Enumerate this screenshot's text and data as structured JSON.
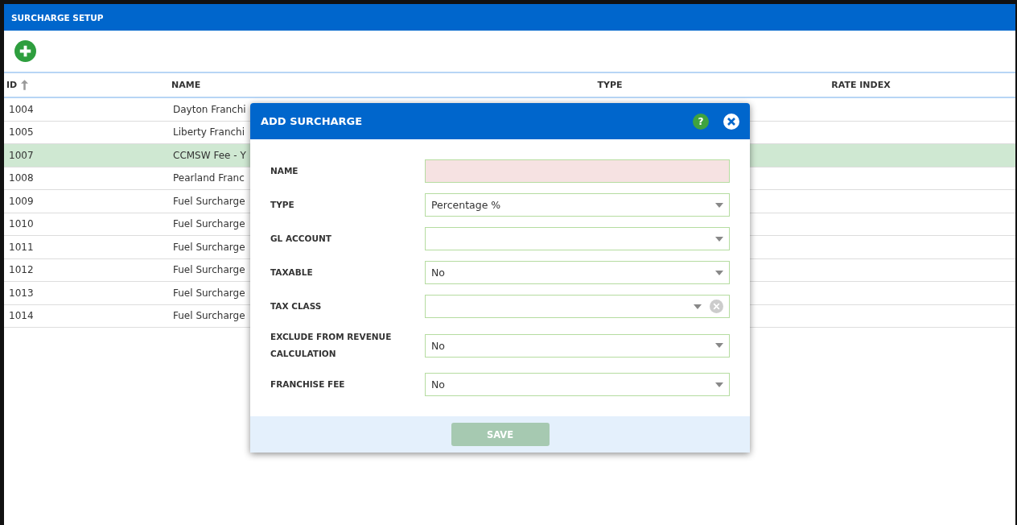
{
  "page": {
    "title": "SURCHARGE SETUP"
  },
  "table": {
    "columns": [
      {
        "label": "ID",
        "sorted": true
      },
      {
        "label": "NAME",
        "sorted": false
      },
      {
        "label": "TYPE",
        "sorted": false
      },
      {
        "label": "RATE INDEX",
        "sorted": false
      }
    ],
    "rows": [
      {
        "id": "1004",
        "name": "Dayton Franchi",
        "selected": false
      },
      {
        "id": "1005",
        "name": "Liberty Franchi",
        "selected": false
      },
      {
        "id": "1007",
        "name": "CCMSW Fee - Y",
        "selected": true
      },
      {
        "id": "1008",
        "name": "Pearland Franc",
        "selected": false
      },
      {
        "id": "1009",
        "name": "Fuel Surcharge",
        "selected": false
      },
      {
        "id": "1010",
        "name": "Fuel Surcharge",
        "selected": false
      },
      {
        "id": "1011",
        "name": "Fuel Surcharge",
        "selected": false
      },
      {
        "id": "1012",
        "name": "Fuel Surcharge",
        "selected": false
      },
      {
        "id": "1013",
        "name": "Fuel Surcharge",
        "selected": false
      },
      {
        "id": "1014",
        "name": "Fuel Surcharge",
        "selected": false
      }
    ]
  },
  "dialog": {
    "title": "ADD SURCHARGE",
    "help": "?",
    "fields": [
      {
        "label": "NAME",
        "kind": "text",
        "invalid": true,
        "clearable": false
      },
      {
        "label": "TYPE",
        "kind": "select",
        "value": "Percentage %",
        "invalid": false,
        "clearable": false
      },
      {
        "label": "GL ACCOUNT",
        "kind": "select",
        "invalid": false,
        "clearable": false
      },
      {
        "label": "TAXABLE",
        "kind": "select",
        "value": "No",
        "invalid": false,
        "clearable": false
      },
      {
        "label": "TAX CLASS",
        "kind": "select",
        "invalid": false,
        "clearable": true
      },
      {
        "label": "EXCLUDE FROM REVENUE CALCULATION",
        "kind": "select",
        "value": "No",
        "invalid": false,
        "clearable": false
      },
      {
        "label": "FRANCHISE FEE",
        "kind": "select",
        "value": "No",
        "invalid": false,
        "clearable": false
      }
    ],
    "save": {
      "label": "SAVE",
      "disabled": true
    }
  }
}
